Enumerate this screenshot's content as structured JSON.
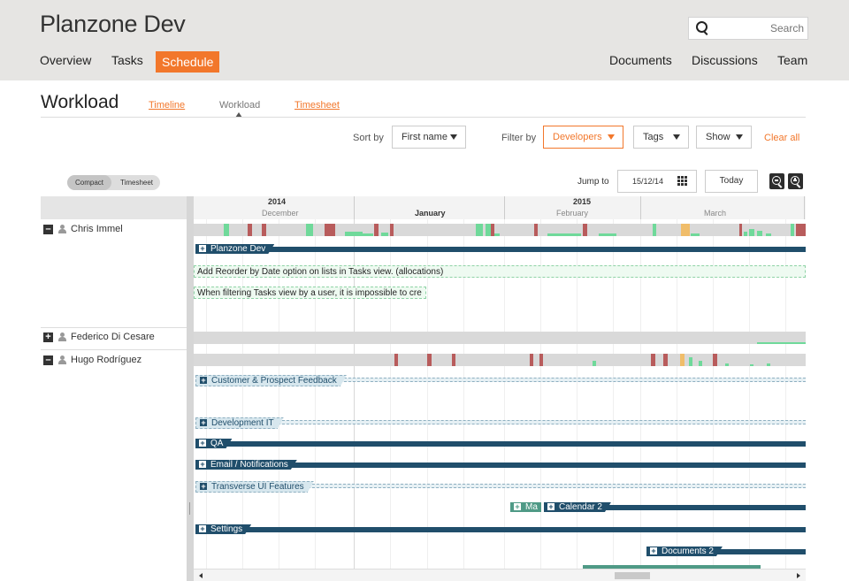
{
  "header": {
    "title": "Planzone Dev",
    "search_placeholder": "Search",
    "nav_left": [
      "Overview",
      "Tasks",
      "Schedule"
    ],
    "nav_right": [
      "Documents",
      "Discussions",
      "Team"
    ],
    "accent_color": "#f2772b"
  },
  "subheader": {
    "title": "Workload",
    "tabs": [
      "Timeline",
      "Workload",
      "Timesheet"
    ],
    "active_tab": "Workload"
  },
  "filters": {
    "sort_by_label": "Sort by",
    "sort_by_value": "First name",
    "filter_by_label": "Filter by",
    "filter_by_value": "Developers",
    "tags_label": "Tags",
    "show_label": "Show",
    "clear_all": "Clear all"
  },
  "toolbar": {
    "view_compact": "Compact",
    "view_timesheet": "Timesheet",
    "jump_to_label": "Jump to",
    "jump_to_date": "15/12/14",
    "today_label": "Today",
    "zoom_out_icon": "zoom-out-icon",
    "zoom_in_icon": "zoom-in-icon"
  },
  "timeline": {
    "years": [
      "2014",
      "2015"
    ],
    "months": [
      "December",
      "January",
      "February",
      "March"
    ],
    "current_month": "January"
  },
  "people": [
    {
      "name": "Chris Immel",
      "expanded": true
    },
    {
      "name": "Federico Di Cesare",
      "expanded": false
    },
    {
      "name": "Hugo Rodríguez",
      "expanded": true
    }
  ],
  "rows": {
    "chris_projects": [
      "Planzone Dev"
    ],
    "chris_tasks": [
      "Add Reorder by Date option on lists in Tasks view. (allocations)",
      "When filtering Tasks view by a user, it is impossible to cre"
    ],
    "hugo_projects": [
      "Customer & Prospect Feedback",
      "Development IT",
      "QA",
      "Email / Notifications",
      "Transverse UI Features",
      "Ma",
      "Calendar 2",
      "Settings",
      "Documents 2"
    ]
  },
  "colors": {
    "project_bar": "#204e6b",
    "overload": "#b85c5c",
    "underload": "#6fd99a",
    "near_full": "#f0bd6a"
  }
}
